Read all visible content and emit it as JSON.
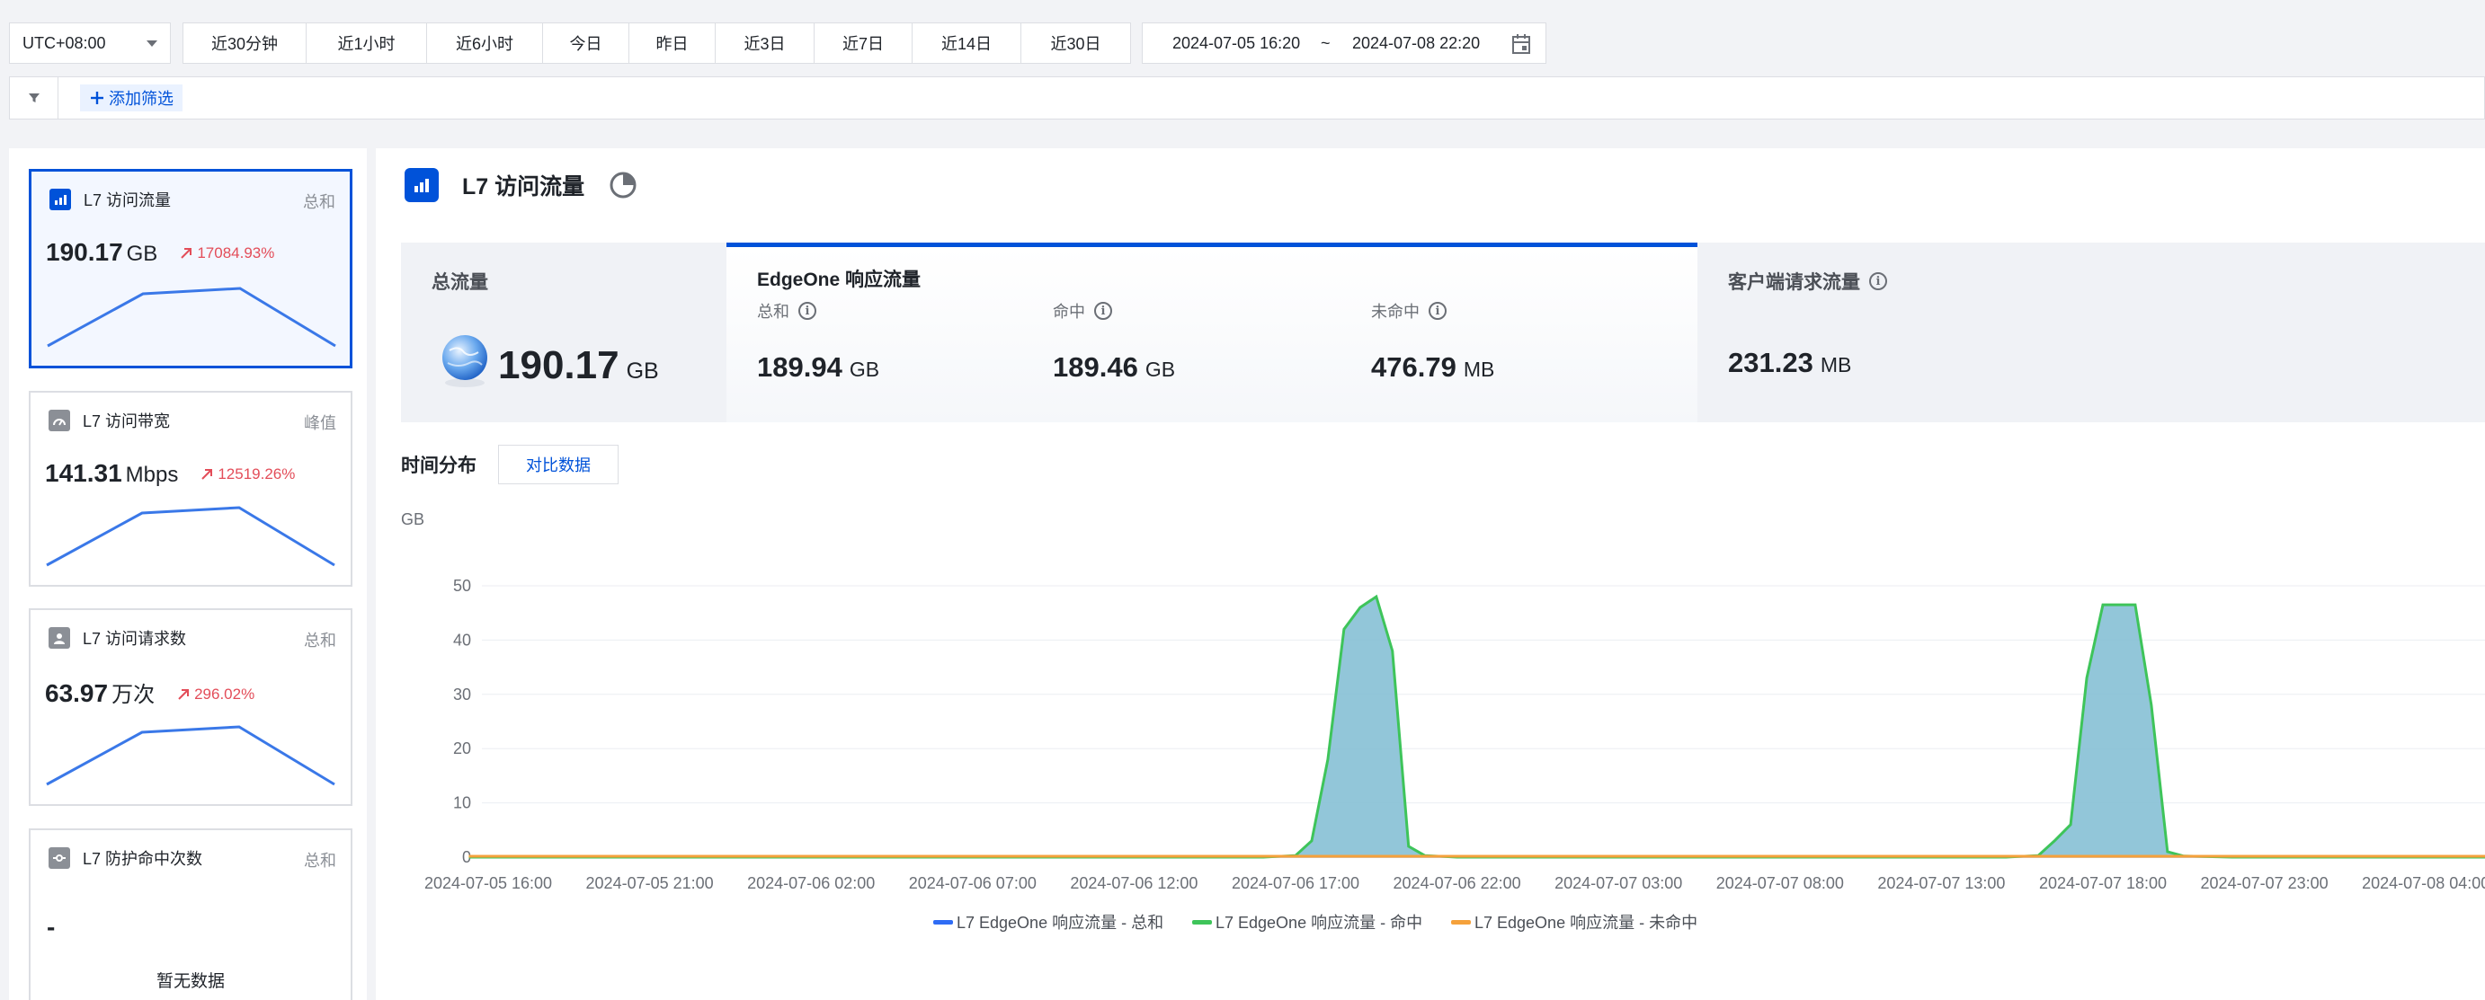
{
  "toolbar": {
    "timezone": "UTC+08:00",
    "ranges": [
      "近30分钟",
      "近1小时",
      "近6小时",
      "今日",
      "昨日",
      "近3日",
      "近7日",
      "近14日",
      "近30日"
    ],
    "date_start": "2024-07-05 16:20",
    "date_sep": "~",
    "date_end": "2024-07-08 22:20"
  },
  "filter": {
    "add_label": "添加筛选"
  },
  "metrics": [
    {
      "title": "L7 访问流量",
      "agg": "总和",
      "value": "190.17",
      "unit": "GB",
      "change": "17084.93%",
      "active": true
    },
    {
      "title": "L7 访问带宽",
      "agg": "峰值",
      "value": "141.31",
      "unit": "Mbps",
      "change": "12519.26%"
    },
    {
      "title": "L7 访问请求数",
      "agg": "总和",
      "value": "63.97",
      "unit": "万次",
      "change": "296.02%"
    },
    {
      "title": "L7 防护命中次数",
      "agg": "总和",
      "value": "-",
      "empty": "暂无数据"
    }
  ],
  "main": {
    "title": "L7 访问流量",
    "total": {
      "title": "总流量",
      "value": "190.17",
      "unit": "GB"
    },
    "edgeone": {
      "title": "EdgeOne 响应流量",
      "items": [
        {
          "label": "总和",
          "value": "189.94",
          "unit": "GB"
        },
        {
          "label": "命中",
          "value": "189.46",
          "unit": "GB"
        },
        {
          "label": "未命中",
          "value": "476.79",
          "unit": "MB"
        }
      ]
    },
    "client": {
      "title": "客户端请求流量",
      "value": "231.23",
      "unit": "MB"
    },
    "dist_title": "时间分布",
    "compare_label": "对比数据"
  },
  "colors": {
    "accent": "#0052d9",
    "total": "#2f6cf5",
    "hit": "#3ec45a",
    "miss": "#f5a13b",
    "area": "#7fbcd2",
    "up": "#e34d59"
  },
  "chart_data": {
    "type": "area",
    "ylabel": "GB",
    "ylim": [
      0,
      50
    ],
    "yticks": [
      0,
      10,
      20,
      30,
      40,
      50
    ],
    "xticks": [
      "2024-07-05 16:00",
      "2024-07-05 21:00",
      "2024-07-06 02:00",
      "2024-07-06 07:00",
      "2024-07-06 12:00",
      "2024-07-06 17:00",
      "2024-07-06 22:00",
      "2024-07-07 03:00",
      "2024-07-07 08:00",
      "2024-07-07 13:00",
      "2024-07-07 18:00",
      "2024-07-07 23:00",
      "2024-07-08 04:00"
    ],
    "legend_position": "bottom",
    "series": [
      {
        "name": "L7 EdgeOne 响应流量 - 总和",
        "color": "#2f6cf5"
      },
      {
        "name": "L7 EdgeOne 响应流量 - 命中",
        "color": "#3ec45a"
      },
      {
        "name": "L7 EdgeOne 响应流量 - 未命中",
        "color": "#f5a13b"
      }
    ],
    "peaks_hours": [
      [
        0,
        0
      ],
      [
        24,
        0
      ],
      [
        25,
        0.3
      ],
      [
        25.5,
        3
      ],
      [
        26,
        18
      ],
      [
        26.5,
        42
      ],
      [
        27,
        46
      ],
      [
        27.5,
        48
      ],
      [
        28,
        38
      ],
      [
        28.5,
        2
      ],
      [
        29,
        0.3
      ],
      [
        30,
        0
      ],
      [
        47,
        0
      ],
      [
        48,
        0.3
      ],
      [
        48.5,
        3
      ],
      [
        49,
        6
      ],
      [
        49.5,
        33
      ],
      [
        50,
        46.5
      ],
      [
        51,
        46.5
      ],
      [
        51.5,
        28
      ],
      [
        52,
        1
      ],
      [
        52.5,
        0.2
      ],
      [
        54,
        0
      ],
      [
        60,
        0
      ]
    ]
  }
}
